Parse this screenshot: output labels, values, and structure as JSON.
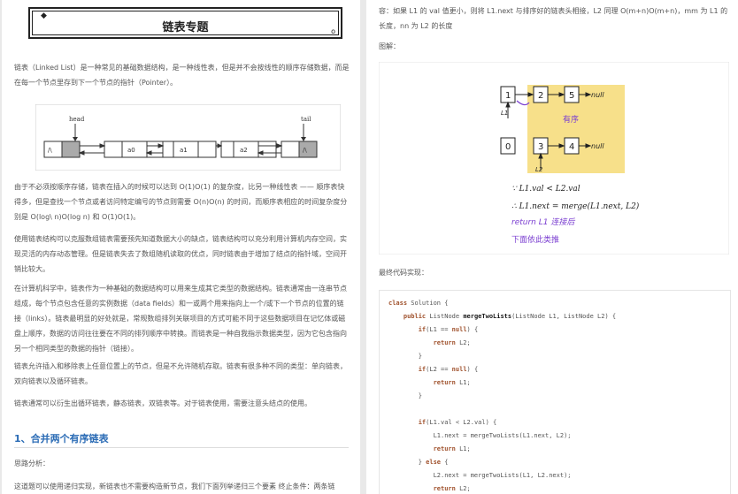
{
  "left": {
    "title": "链表专题",
    "title_deco_left": "◆",
    "title_deco_right": "o",
    "p1": "链表（Linked List）是一种常见的基础数据结构，是一种线性表，但是并不会按线性的顺序存储数据，而是在每一个节点里存到下一个节点的指针（Pointer）。",
    "diagram": {
      "head_label": "head",
      "tail_label": "tail",
      "nodes": [
        "a0",
        "a1",
        "a2"
      ],
      "null_symbol": "/\\"
    },
    "p2": "由于不必须按顺序存储，链表在插入的时候可以达到 O(1)O(1) 的复杂度，比另一种线性表 —— 顺序表快得多，但是查找一个节点或者访问特定编号的节点则需要 O(n)O(n) 的时间，而顺序表相应的时间复杂度分别是 O(log\\ n)O(log n) 和 O(1)O(1)。",
    "p3": "使用链表结构可以克服数组链表需要预先知道数据大小的缺点，链表结构可以充分利用计算机内存空间，实现灵活的内存动态管理。但是链表失去了数组随机读取的优点，同时链表由于增加了结点的指针域，空间开销比较大。",
    "p4": "在计算机科学中，链表作为一种基础的数据结构可以用来生成其它类型的数据结构。链表通常由一连串节点组成，每个节点包含任意的实例数据（data fields）和一或两个用来指向上一个/或下一个节点的位置的链接（links）。链表最明显的好处就是，常规数组排列关联项目的方式可能不同于这些数据项目在记忆体或磁盘上顺序，数据的访问往往要在不同的排列顺序中转换。而链表是一种自我指示数据类型，因为它包含指向另一个相同类型的数据的指针（链接）。",
    "p5": "链表允许插入和移除表上任意位置上的节点，但是不允许随机存取。链表有很多种不同的类型：单向链表，双向链表以及循环链表。",
    "p6": "链表通常可以衍生出循环链表，静态链表，双链表等。对于链表使用，需要注意头结点的使用。",
    "h2": "1、合并两个有序链表",
    "p7": "思路分析：",
    "p8": "这道题可以使用递归实现，新链表也不需要构造新节点，我们下面列举递归三个要素 终止条件：两条链"
  },
  "right": {
    "p1": "容：如果 L1 的 val 值更小，则将 L1.next 与排序好的链表头相接，L2 同理 O(m+n)O(m+n)，mm 为 L1 的长度，nn 为 L2 的长度",
    "p2": "图解：",
    "figure": {
      "top_row": [
        "1",
        "2",
        "5"
      ],
      "bottom_row": [
        "0",
        "3",
        "4"
      ],
      "null_text": "null",
      "l1_label": "L1",
      "l2_label": "L2",
      "sorted_label": "有序",
      "hand_line1": "∵ L1.val < L2.val",
      "hand_line2": "∴ L1.next = merge(L1.next, L2)",
      "hand_line3": "return L1 连接后",
      "hand_line4": "下面依此类推",
      "highlight_color": "#f7e08a",
      "ink_color": "#7b3fd1"
    },
    "p3": "最终代码实现：",
    "code": [
      "class Solution {",
      "    public ListNode mergeTwoLists(ListNode L1, ListNode L2) {",
      "        if(L1 == null) {",
      "            return L2;",
      "        }",
      "        if(L2 == null) {",
      "            return L1;",
      "        }",
      "",
      "        if(L1.val < L2.val) {",
      "            L1.next = mergeTwoLists(L1.next, L2);",
      "            return L1;",
      "        } else {",
      "            L2.next = mergeTwoLists(L1, L2.next);",
      "            return L2;",
      "        }"
    ]
  }
}
